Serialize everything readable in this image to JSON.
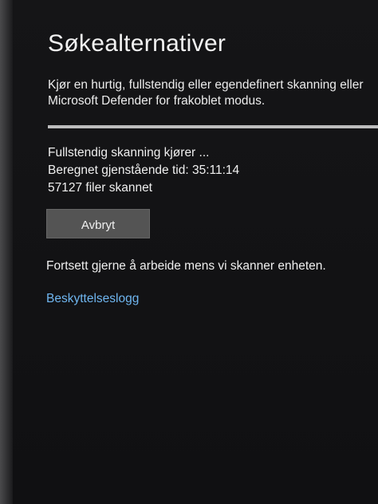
{
  "page": {
    "title": "Søkealternativer",
    "description_line1": "Kjør en hurtig, fullstendig eller egendefinert skanning eller",
    "description_line2": "Microsoft Defender for frakoblet modus."
  },
  "scan": {
    "progress_fraction": 1.0,
    "status_line": "Fullstendig skanning kjører ...",
    "remaining_label": "Beregnet gjenstående tid:",
    "remaining_time": "35:11:14",
    "files_count": "57127",
    "files_label": "filer skannet"
  },
  "actions": {
    "cancel_label": "Avbryt",
    "continue_message": "Fortsett gjerne å arbeide mens vi skanner enheten.",
    "history_link": "Beskyttelseslogg"
  },
  "colors": {
    "background": "#121214",
    "text": "#efefef",
    "link": "#6fb6f0",
    "button": "#545454"
  }
}
